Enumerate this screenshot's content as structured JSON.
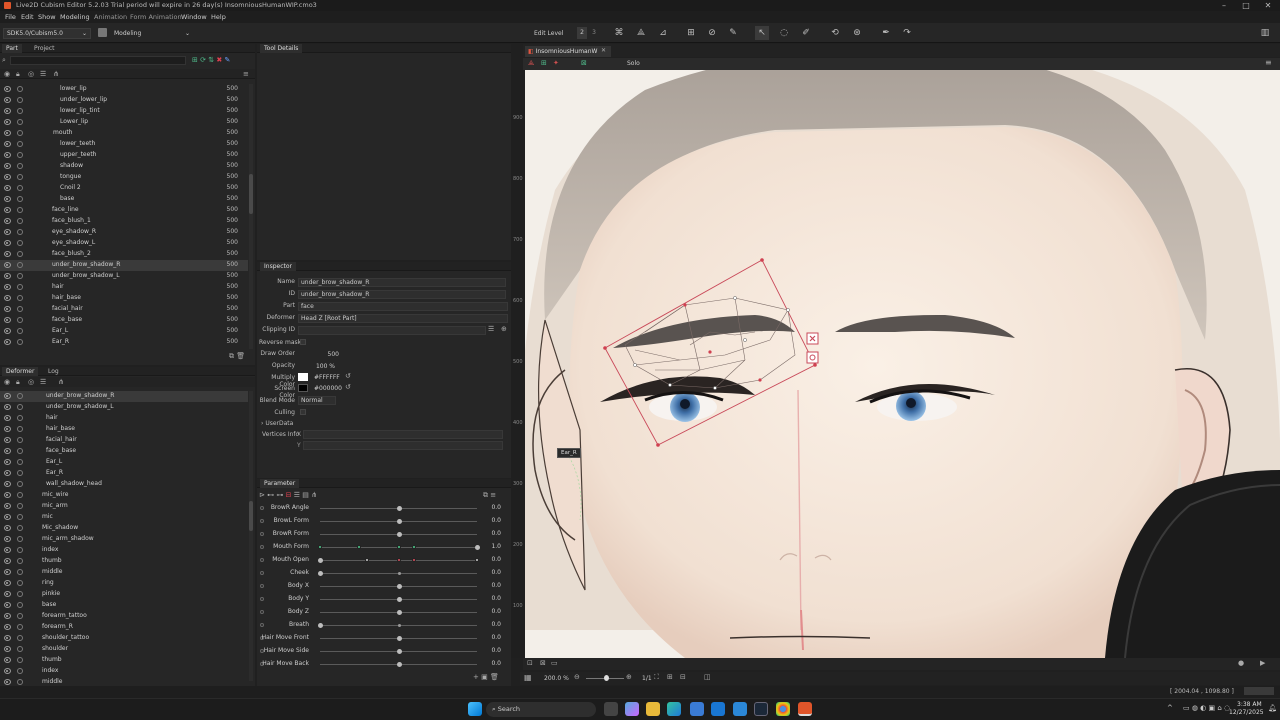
{
  "titlebar": {
    "title": "Live2D Cubism Editor 5.2.03   Trial period will expire in 26 day(s)   InsomniousHumanWIP.cmo3"
  },
  "menu": [
    "File",
    "Edit",
    "Show",
    "Modeling",
    "Animation",
    "Form Animation",
    "Window",
    "Help"
  ],
  "toolbar": {
    "sdk": "SDK5.0/Cubism5.0",
    "mode": "Modeling",
    "edit_level_label": "Edit Level",
    "edit_levels": [
      "2",
      "3"
    ]
  },
  "left_tabs": {
    "part": "Part",
    "project": "Project"
  },
  "parts": [
    {
      "name": "lower_lip",
      "val": "500",
      "indent": 60
    },
    {
      "name": "under_lower_lip",
      "val": "500",
      "indent": 60
    },
    {
      "name": "lower_lip_tint",
      "val": "500",
      "indent": 60
    },
    {
      "name": "Lower_lip",
      "val": "500",
      "indent": 60
    },
    {
      "name": "mouth",
      "val": "500",
      "indent": 53
    },
    {
      "name": "lower_teeth",
      "val": "500",
      "indent": 60
    },
    {
      "name": "upper_teeth",
      "val": "500",
      "indent": 60
    },
    {
      "name": "shadow",
      "val": "500",
      "indent": 60
    },
    {
      "name": "tongue",
      "val": "500",
      "indent": 60
    },
    {
      "name": "Cnoil 2",
      "val": "500",
      "indent": 60
    },
    {
      "name": "base",
      "val": "500",
      "indent": 60
    },
    {
      "name": "face_line",
      "val": "500",
      "indent": 52
    },
    {
      "name": "face_blush_1",
      "val": "500",
      "indent": 52
    },
    {
      "name": "eye_shadow_R",
      "val": "500",
      "indent": 52
    },
    {
      "name": "eye_shadow_L",
      "val": "500",
      "indent": 52
    },
    {
      "name": "face_blush_2",
      "val": "500",
      "indent": 52
    },
    {
      "name": "under_brow_shadow_R",
      "val": "500",
      "indent": 52,
      "sel": true
    },
    {
      "name": "under_brow_shadow_L",
      "val": "500",
      "indent": 52
    },
    {
      "name": "hair",
      "val": "500",
      "indent": 52
    },
    {
      "name": "hair_base",
      "val": "500",
      "indent": 52
    },
    {
      "name": "facial_hair",
      "val": "500",
      "indent": 52
    },
    {
      "name": "face_base",
      "val": "500",
      "indent": 52
    },
    {
      "name": "Ear_L",
      "val": "500",
      "indent": 52
    },
    {
      "name": "Ear_R",
      "val": "500",
      "indent": 52
    }
  ],
  "deformer_tabs": {
    "deformer": "Deformer",
    "log": "Log"
  },
  "deformers": [
    {
      "name": "under_brow_shadow_R",
      "indent": 46,
      "sel": true
    },
    {
      "name": "under_brow_shadow_L",
      "indent": 46
    },
    {
      "name": "hair",
      "indent": 46
    },
    {
      "name": "hair_base",
      "indent": 46
    },
    {
      "name": "facial_hair",
      "indent": 46
    },
    {
      "name": "face_base",
      "indent": 46
    },
    {
      "name": "Ear_L",
      "indent": 46
    },
    {
      "name": "Ear_R",
      "indent": 46
    },
    {
      "name": "wall_shadow_head",
      "indent": 46
    },
    {
      "name": "mic_wire",
      "indent": 42
    },
    {
      "name": "mic_arm",
      "indent": 42
    },
    {
      "name": "mic",
      "indent": 42
    },
    {
      "name": "Mic_shadow",
      "indent": 42
    },
    {
      "name": "mic_arm_shadow",
      "indent": 42
    },
    {
      "name": "index",
      "indent": 42
    },
    {
      "name": "thumb",
      "indent": 42
    },
    {
      "name": "middle",
      "indent": 42
    },
    {
      "name": "ring",
      "indent": 42
    },
    {
      "name": "pinkie",
      "indent": 42
    },
    {
      "name": "base",
      "indent": 42
    },
    {
      "name": "forearm_tattoo",
      "indent": 42
    },
    {
      "name": "forearm_R",
      "indent": 42
    },
    {
      "name": "shoulder_tattoo",
      "indent": 42
    },
    {
      "name": "shoulder",
      "indent": 42
    },
    {
      "name": "thumb",
      "indent": 42
    },
    {
      "name": "index",
      "indent": 42
    },
    {
      "name": "middle",
      "indent": 42
    }
  ],
  "tool_details": {
    "title": "Tool Details"
  },
  "inspector": {
    "title": "Inspector",
    "fields": [
      {
        "label": "Name",
        "value": "under_brow_shadow_R"
      },
      {
        "label": "ID",
        "value": "under_brow_shadow_R"
      },
      {
        "label": "Part",
        "value": "face"
      },
      {
        "label": "Deformer",
        "value": "Head Z  [Root Part]"
      },
      {
        "label": "Clipping ID",
        "value": ""
      }
    ],
    "reverse_mask": "Reverse mask",
    "draw_order_label": "Draw Order",
    "draw_order": "500",
    "opacity_label": "Opacity",
    "opacity": "100 %",
    "multiply_label": "Multiply Color",
    "multiply": "#FFFFFF",
    "screen_label": "Screen Color",
    "screen": "#000000",
    "blend_label": "Blend Mode",
    "blend": "Normal",
    "culling_label": "Culling",
    "userdata_label": "UserData",
    "vertices_label": "Vertices Info",
    "vx": "X",
    "vy": "Y"
  },
  "parameter": {
    "title": "Parameter",
    "rows": [
      {
        "name": "BrowR Angle",
        "value": "0.0",
        "pos": 0.5
      },
      {
        "name": "BrowL Form",
        "value": "0.0",
        "pos": 0.5
      },
      {
        "name": "BrowR Form",
        "value": "0.0",
        "pos": 0.5
      },
      {
        "name": "Mouth Form",
        "value": "1.0",
        "pos": 1.0,
        "keys": [
          0,
          0.25,
          0.5,
          0.6,
          1.0
        ],
        "color": "#4fcf8f"
      },
      {
        "name": "Mouth Open",
        "value": "0.0",
        "pos": 0.0,
        "keys": [
          0,
          0.3,
          0.5,
          0.6,
          1.0
        ],
        "color": "#e05060"
      },
      {
        "name": "Cheek",
        "value": "0.0",
        "pos": 0.0
      },
      {
        "name": "Body X",
        "value": "0.0",
        "pos": 0.5
      },
      {
        "name": "Body Y",
        "value": "0.0",
        "pos": 0.5
      },
      {
        "name": "Body Z",
        "value": "0.0",
        "pos": 0.5
      },
      {
        "name": "Breath",
        "value": "0.0",
        "pos": 0.0
      },
      {
        "name": "Hair Move Front",
        "value": "0.0",
        "pos": 0.5
      },
      {
        "name": "Hair Move Side",
        "value": "0.0",
        "pos": 0.5
      },
      {
        "name": "Hair Move Back",
        "value": "0.0",
        "pos": 0.5
      }
    ]
  },
  "view": {
    "tab": "InsomniousHumanW",
    "solo": "Solo",
    "ear_tag": "Ear_R",
    "ruler": [
      "900",
      "800",
      "700",
      "600",
      "500",
      "400",
      "300",
      "200",
      "100"
    ],
    "zoom": "200.0 %",
    "ratio": "1/1"
  },
  "status": {
    "coords": "[ 2004.04 , 1098.80 ]"
  },
  "taskbar": {
    "search": "Search",
    "time": "3:38 AM",
    "date": "12/27/2025"
  }
}
